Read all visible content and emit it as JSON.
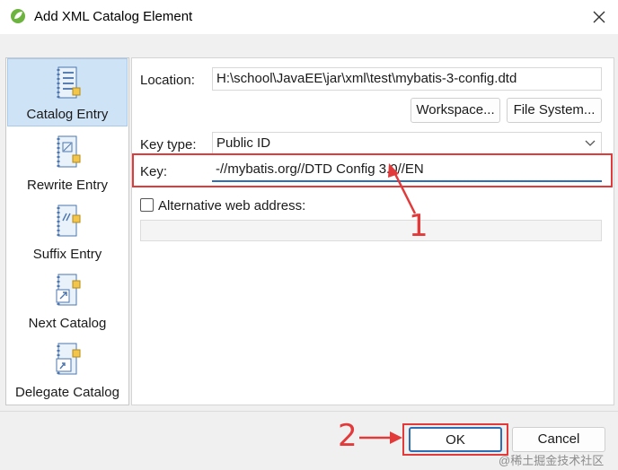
{
  "window": {
    "title": "Add XML Catalog Element",
    "close_glyph": "✕"
  },
  "nav": {
    "items": [
      {
        "label": "Catalog Entry",
        "icon": "catalog-entry-icon"
      },
      {
        "label": "Rewrite Entry",
        "icon": "rewrite-entry-icon"
      },
      {
        "label": "Suffix Entry",
        "icon": "suffix-entry-icon"
      },
      {
        "label": "Next Catalog",
        "icon": "next-catalog-icon"
      },
      {
        "label": "Delegate Catalog",
        "icon": "delegate-catalog-icon"
      }
    ],
    "selected": "Catalog Entry"
  },
  "form": {
    "location_label": "Location:",
    "location_value": "H:\\school\\JavaEE\\jar\\xml\\test\\mybatis-3-config.dtd",
    "workspace_button": "Workspace...",
    "file_system_button": "File System...",
    "key_type_label": "Key type:",
    "key_type_value": "Public ID",
    "key_label": "Key:",
    "key_value": "-//mybatis.org//DTD Config 3.0//EN",
    "alt_checkbox_label": "Alternative web address:",
    "alt_checkbox_checked": false,
    "alt_web_value": ""
  },
  "footer": {
    "ok_button": "OK",
    "cancel_button": "Cancel"
  },
  "annotations": {
    "marker_1": "1",
    "marker_2": "2",
    "highlight_color": "#e23a3a"
  },
  "watermark": "@稀土掘金技术社区"
}
